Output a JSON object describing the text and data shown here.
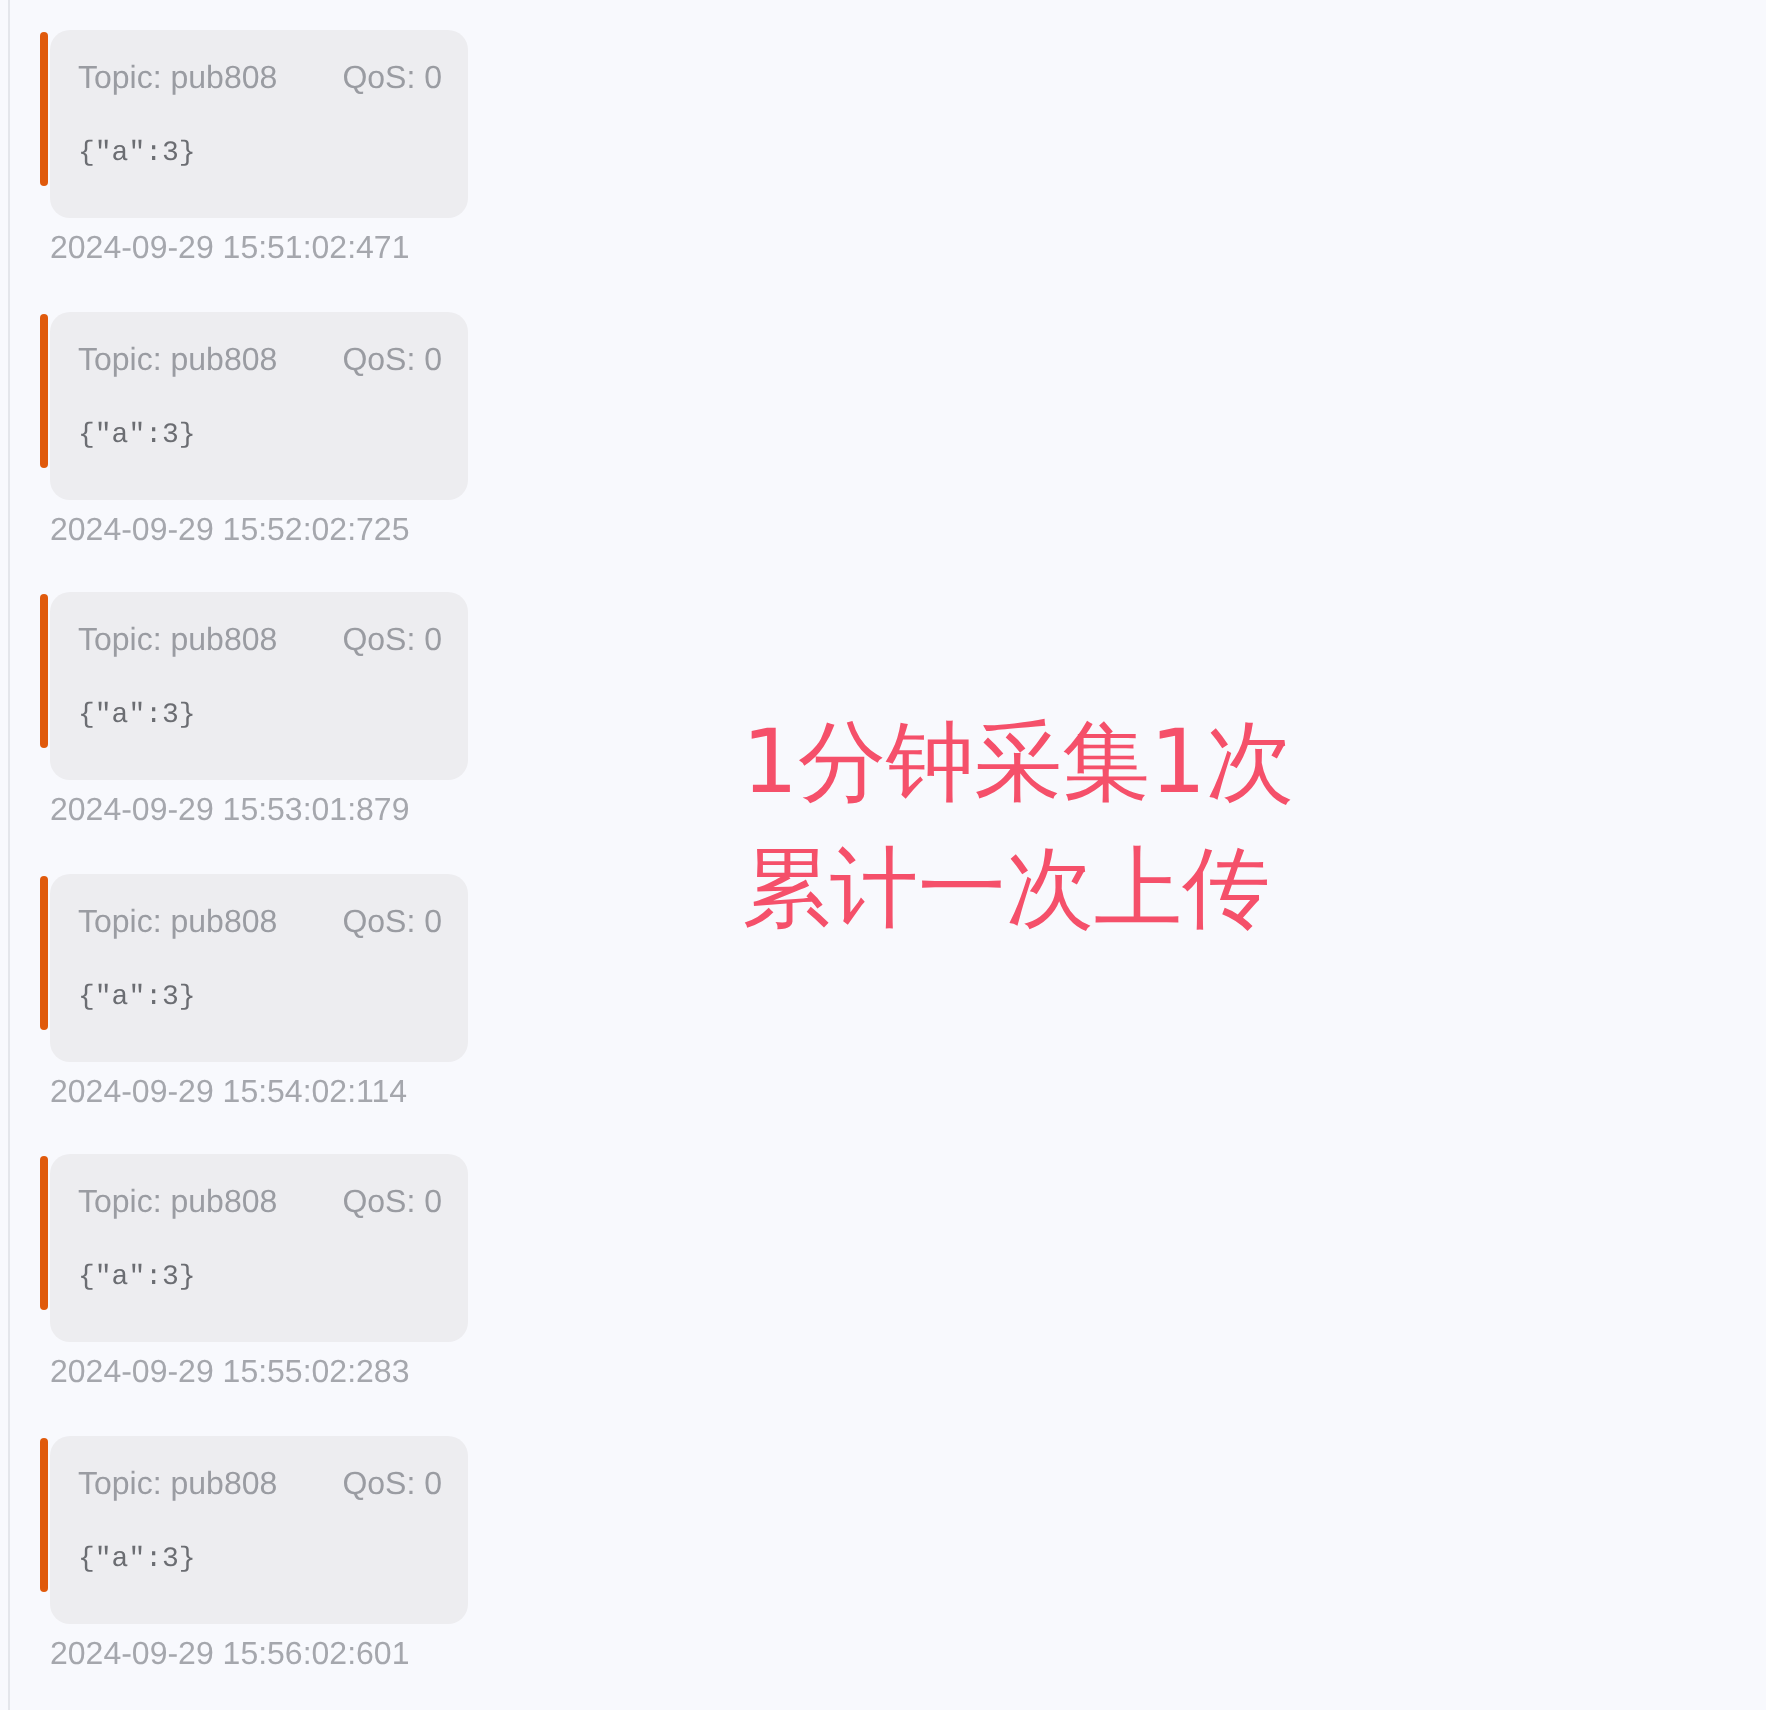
{
  "messages": [
    {
      "topic": "Topic: pub808",
      "qos": "QoS: 0",
      "payload": "{\"a\":3}",
      "time": "2024-09-29 15:51:02:471"
    },
    {
      "topic": "Topic: pub808",
      "qos": "QoS: 0",
      "payload": "{\"a\":3}",
      "time": "2024-09-29 15:52:02:725"
    },
    {
      "topic": "Topic: pub808",
      "qos": "QoS: 0",
      "payload": "{\"a\":3}",
      "time": "2024-09-29 15:53:01:879"
    },
    {
      "topic": "Topic: pub808",
      "qos": "QoS: 0",
      "payload": "{\"a\":3}",
      "time": "2024-09-29 15:54:02:114"
    },
    {
      "topic": "Topic: pub808",
      "qos": "QoS: 0",
      "payload": "{\"a\":3}",
      "time": "2024-09-29 15:55:02:283"
    },
    {
      "topic": "Topic: pub808",
      "qos": "QoS: 0",
      "payload": "{\"a\":3}",
      "time": "2024-09-29 15:56:02:601"
    }
  ],
  "annotation": [
    "1分钟采集1次",
    "累计一次上传"
  ]
}
